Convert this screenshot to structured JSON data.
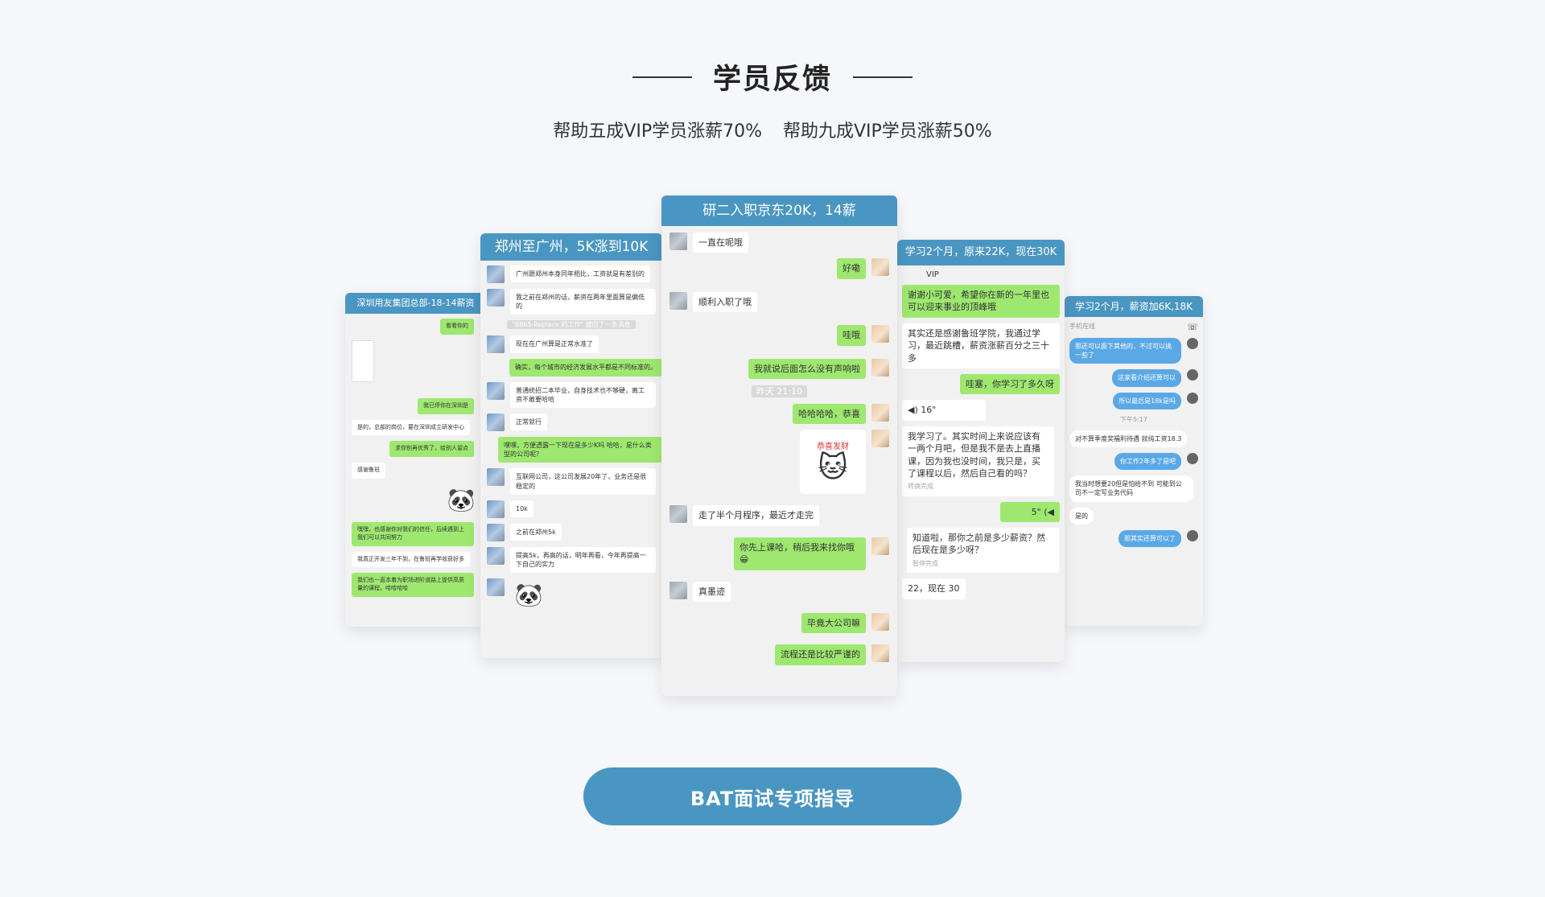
{
  "header": {
    "title": "学员反馈",
    "subtitle_left": "帮助五成VIP学员涨薪70%",
    "subtitle_right": "帮助九成VIP学员涨薪50%"
  },
  "cards": {
    "c1": {
      "title": "深圳用友集团总部-18-14薪资",
      "messages": [
        "看看你的",
        "我已停你在深圳是",
        "是的，总部的岗位，要在深圳成立研发中心",
        "求你别再优秀了，给别人留点",
        "感谢鲁班",
        "嘿嘿，也感谢你对我们的信任，后续遇到上我们可以共同努力",
        "我真正开发三年不到，在鲁班再学收获好多",
        "我们也一直本着为职场进阶道路上提供高质量的课程，哈哈哈哈"
      ]
    },
    "c2": {
      "title": "郑州至广州，5K涨到10K",
      "messages": [
        "广州跟郑州本身同年相比，工资就是有差别的",
        "我之前在郑州的话，薪资在两年里面算是偏低的",
        "\"6865-Replace 的工作\" 撤回了一条消息",
        "现在在广州算是正常水准了",
        "确实，每个城市的经济发展水平都是不同标准的。",
        "普通统招二本毕业，自身技术也不够硬，离工资不敢要哈哈",
        "正常就行",
        "嘿嘿，方便透露一下现在是多少K吗 哈哈，是什么类型的公司呢？",
        "互联网公司，这公司发展20年了，业务还是很稳定的",
        "10k",
        "之前在郑州5k",
        "提高5k，再高的话，明年再看，今年再提高一下自己的实力"
      ]
    },
    "c3": {
      "title": "研二入职京东20K，14薪",
      "messages": [
        "一直在呢哦",
        "好嘞",
        "顺利入职了哦",
        "哇哦",
        "我就说后面怎么没有声响啦",
        "昨天 21:10",
        "哈哈哈哈，恭喜",
        "走了半个月程序，最近才走完",
        "你先上课哈，稍后我来找你哦",
        "真墨迹",
        "毕竟大公司嘛",
        "流程还是比较严谨的"
      ],
      "sticker_text": "恭喜发财"
    },
    "c4": {
      "title": "学习2个月，原来22K，现在30K",
      "messages": [
        "VIP",
        "谢谢小可爱，希望你在新的一年里也可以迎来事业的顶峰哦",
        "其实还是感谢鲁班学院，我通过学习，最近跳槽，薪资涨薪百分之三十多",
        "哇塞，你学习了多久呀",
        "16\"",
        "我学习了。其实时间上来说应该有一两个月吧，但是我不是去上直播课，因为我也没时间，我只是，买了课程以后，然后自己看的吗？",
        "转换完成",
        "5\"",
        "知道啦，那你之前是多少薪资？然后现在是多少呀？",
        "暂停完成",
        "22，现在 30"
      ]
    },
    "c5": {
      "title": "学习2个月，薪资加6K,18K",
      "messages": [
        "手机在线",
        "那还可以面下其他的，不过可以挑一些了",
        "这家看介绍还算可以",
        "所以最后是18k是吗",
        "下午5:17",
        "对不算季度奖福利待遇 就纯工资18.3",
        "你工作2年多了是吧",
        "我当时想要20但是怕给不到 可能到公司不一定写业务代码",
        "是的",
        "那其实还算可以了"
      ]
    }
  },
  "cta": {
    "label": "BAT面试专项指导"
  },
  "icons": {
    "cat": "cat-face",
    "panda": "panda-face",
    "phone": "phone-icon",
    "voice": "voice-icon"
  },
  "colors": {
    "accent": "#4a96c2",
    "bubble_green": "#9ee870",
    "bubble_blue": "#5aa8e6",
    "background": "#f5f7fa"
  }
}
